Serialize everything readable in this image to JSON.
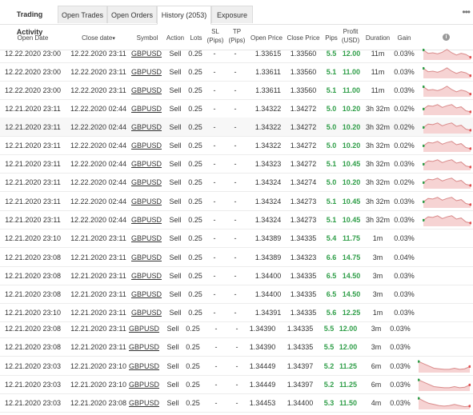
{
  "tabs": {
    "title": "Trading Activity",
    "open_trades": "Open Trades",
    "open_orders": "Open Orders",
    "history": "History (2053)",
    "exposure": "Exposure"
  },
  "headers": {
    "open_date": "Open Date",
    "close_date": "Close date",
    "sort_indicator": "▾",
    "symbol": "Symbol",
    "action": "Action",
    "lots": "Lots",
    "sl_1": "SL",
    "sl_2": "(Pips)",
    "tp_1": "TP",
    "tp_2": "(Pips)",
    "open_price": "Open Price",
    "close_price": "Close Price",
    "pips": "Pips",
    "profit_1": "Profit",
    "profit_2": "(USD)",
    "duration": "Duration",
    "gain": "Gain",
    "info": "i"
  },
  "colors": {
    "profit_green": "#2f9e48",
    "spark_fill": "#f6d3d3",
    "spark_line": "#d98a8a",
    "spark_start": "#2f9e48",
    "spark_end": "#e05050"
  },
  "rows": [
    {
      "open": "12.22.2020 23:00",
      "close": "12.22.2020 23:11",
      "symbol": "GBPUSD",
      "action": "Sell",
      "lots": "0.25",
      "sl": "-",
      "tp": "-",
      "open_price": "1.33615",
      "close_price": "1.33560",
      "pips": "5.5",
      "profit": "12.00",
      "duration": "11m",
      "gain": "0.03%",
      "spark": [
        0.25,
        0.55,
        0.5,
        0.6,
        0.45,
        0.2,
        0.5,
        0.7,
        0.55,
        0.65,
        0.9
      ]
    },
    {
      "open": "12.22.2020 23:00",
      "close": "12.22.2020 23:11",
      "symbol": "GBPUSD",
      "action": "Sell",
      "lots": "0.25",
      "sl": "-",
      "tp": "-",
      "open_price": "1.33611",
      "close_price": "1.33560",
      "pips": "5.1",
      "profit": "11.00",
      "duration": "11m",
      "gain": "0.03%",
      "spark": [
        0.25,
        0.55,
        0.5,
        0.6,
        0.45,
        0.2,
        0.5,
        0.7,
        0.55,
        0.65,
        0.9
      ]
    },
    {
      "open": "12.22.2020 23:00",
      "close": "12.22.2020 23:11",
      "symbol": "GBPUSD",
      "action": "Sell",
      "lots": "0.25",
      "sl": "-",
      "tp": "-",
      "open_price": "1.33611",
      "close_price": "1.33560",
      "pips": "5.1",
      "profit": "11.00",
      "duration": "11m",
      "gain": "0.03%",
      "spark": [
        0.25,
        0.55,
        0.5,
        0.6,
        0.45,
        0.2,
        0.5,
        0.7,
        0.55,
        0.65,
        0.9
      ]
    },
    {
      "open": "12.21.2020 23:11",
      "close": "12.22.2020 02:44",
      "symbol": "GBPUSD",
      "action": "Sell",
      "lots": "0.25",
      "sl": "-",
      "tp": "-",
      "open_price": "1.34322",
      "close_price": "1.34272",
      "pips": "5.0",
      "profit": "10.20",
      "duration": "3h 32m",
      "gain": "0.02%",
      "spark": [
        0.6,
        0.3,
        0.35,
        0.2,
        0.45,
        0.3,
        0.2,
        0.5,
        0.4,
        0.75,
        0.85
      ]
    },
    {
      "open": "12.21.2020 23:11",
      "close": "12.22.2020 02:44",
      "symbol": "GBPUSD",
      "action": "Sell",
      "lots": "0.25",
      "sl": "-",
      "tp": "-",
      "open_price": "1.34322",
      "close_price": "1.34272",
      "pips": "5.0",
      "profit": "10.20",
      "duration": "3h 32m",
      "gain": "0.02%",
      "spark": [
        0.6,
        0.3,
        0.35,
        0.2,
        0.45,
        0.3,
        0.2,
        0.5,
        0.4,
        0.75,
        0.85
      ]
    },
    {
      "open": "12.21.2020 23:11",
      "close": "12.22.2020 02:44",
      "symbol": "GBPUSD",
      "action": "Sell",
      "lots": "0.25",
      "sl": "-",
      "tp": "-",
      "open_price": "1.34322",
      "close_price": "1.34272",
      "pips": "5.0",
      "profit": "10.20",
      "duration": "3h 32m",
      "gain": "0.02%",
      "spark": [
        0.6,
        0.3,
        0.35,
        0.2,
        0.45,
        0.3,
        0.2,
        0.5,
        0.4,
        0.75,
        0.85
      ]
    },
    {
      "open": "12.21.2020 23:11",
      "close": "12.22.2020 02:44",
      "symbol": "GBPUSD",
      "action": "Sell",
      "lots": "0.25",
      "sl": "-",
      "tp": "-",
      "open_price": "1.34323",
      "close_price": "1.34272",
      "pips": "5.1",
      "profit": "10.45",
      "duration": "3h 32m",
      "gain": "0.03%",
      "spark": [
        0.6,
        0.3,
        0.35,
        0.2,
        0.45,
        0.3,
        0.2,
        0.5,
        0.4,
        0.75,
        0.85
      ]
    },
    {
      "open": "12.21.2020 23:11",
      "close": "12.22.2020 02:44",
      "symbol": "GBPUSD",
      "action": "Sell",
      "lots": "0.25",
      "sl": "-",
      "tp": "-",
      "open_price": "1.34324",
      "close_price": "1.34274",
      "pips": "5.0",
      "profit": "10.20",
      "duration": "3h 32m",
      "gain": "0.02%",
      "spark": [
        0.6,
        0.3,
        0.35,
        0.2,
        0.45,
        0.3,
        0.2,
        0.5,
        0.4,
        0.75,
        0.85
      ]
    },
    {
      "open": "12.21.2020 23:11",
      "close": "12.22.2020 02:44",
      "symbol": "GBPUSD",
      "action": "Sell",
      "lots": "0.25",
      "sl": "-",
      "tp": "-",
      "open_price": "1.34324",
      "close_price": "1.34273",
      "pips": "5.1",
      "profit": "10.45",
      "duration": "3h 32m",
      "gain": "0.03%",
      "spark": [
        0.6,
        0.3,
        0.35,
        0.2,
        0.45,
        0.3,
        0.2,
        0.5,
        0.4,
        0.75,
        0.85
      ]
    },
    {
      "open": "12.21.2020 23:11",
      "close": "12.22.2020 02:44",
      "symbol": "GBPUSD",
      "action": "Sell",
      "lots": "0.25",
      "sl": "-",
      "tp": "-",
      "open_price": "1.34324",
      "close_price": "1.34273",
      "pips": "5.1",
      "profit": "10.45",
      "duration": "3h 32m",
      "gain": "0.03%",
      "spark": [
        0.6,
        0.3,
        0.35,
        0.2,
        0.45,
        0.3,
        0.2,
        0.5,
        0.4,
        0.75,
        0.85
      ]
    },
    {
      "open": "12.21.2020 23:10",
      "close": "12.21.2020 23:11",
      "symbol": "GBPUSD",
      "action": "Sell",
      "lots": "0.25",
      "sl": "-",
      "tp": "-",
      "open_price": "1.34389",
      "close_price": "1.34335",
      "pips": "5.4",
      "profit": "11.75",
      "duration": "1m",
      "gain": "0.03%",
      "spark": null
    },
    {
      "open": "12.21.2020 23:08",
      "close": "12.21.2020 23:11",
      "symbol": "GBPUSD",
      "action": "Sell",
      "lots": "0.25",
      "sl": "-",
      "tp": "-",
      "open_price": "1.34389",
      "close_price": "1.34323",
      "pips": "6.6",
      "profit": "14.75",
      "duration": "3m",
      "gain": "0.04%",
      "spark": null
    },
    {
      "open": "12.21.2020 23:08",
      "close": "12.21.2020 23:11",
      "symbol": "GBPUSD",
      "action": "Sell",
      "lots": "0.25",
      "sl": "-",
      "tp": "-",
      "open_price": "1.34400",
      "close_price": "1.34335",
      "pips": "6.5",
      "profit": "14.50",
      "duration": "3m",
      "gain": "0.03%",
      "spark": null
    },
    {
      "open": "12.21.2020 23:08",
      "close": "12.21.2020 23:11",
      "symbol": "GBPUSD",
      "action": "Sell",
      "lots": "0.25",
      "sl": "-",
      "tp": "-",
      "open_price": "1.34400",
      "close_price": "1.34335",
      "pips": "6.5",
      "profit": "14.50",
      "duration": "3m",
      "gain": "0.03%",
      "spark": null
    },
    {
      "open": "12.21.2020 23:10",
      "close": "12.21.2020 23:11",
      "symbol": "GBPUSD",
      "action": "Sell",
      "lots": "0.25",
      "sl": "-",
      "tp": "-",
      "open_price": "1.34391",
      "close_price": "1.34335",
      "pips": "5.6",
      "profit": "12.25",
      "duration": "1m",
      "gain": "0.03%",
      "spark": null
    },
    {
      "open": "12.21.2020 23:08",
      "close": "12.21.2020 23:11",
      "symbol": "GBPUSD",
      "action": "Sell",
      "lots": "0.25",
      "sl": "-",
      "tp": "-",
      "open_price": "1.34390",
      "close_price": "1.34335",
      "pips": "5.5",
      "profit": "12.00",
      "duration": "3m",
      "gain": "0.03%",
      "spark": null
    },
    {
      "open": "12.21.2020 23:08",
      "close": "12.21.2020 23:11",
      "symbol": "GBPUSD",
      "action": "Sell",
      "lots": "0.25",
      "sl": "-",
      "tp": "-",
      "open_price": "1.34390",
      "close_price": "1.34335",
      "pips": "5.5",
      "profit": "12.00",
      "duration": "3m",
      "gain": "0.03%",
      "spark": null
    },
    {
      "open": "12.21.2020 23:03",
      "close": "12.21.2020 23:10",
      "symbol": "GBPUSD",
      "action": "Sell",
      "lots": "0.25",
      "sl": "-",
      "tp": "-",
      "open_price": "1.34449",
      "close_price": "1.34397",
      "pips": "5.2",
      "profit": "11.25",
      "duration": "6m",
      "gain": "0.03%",
      "spark": [
        0.15,
        0.35,
        0.55,
        0.75,
        0.8,
        0.85,
        0.85,
        0.75,
        0.85,
        0.8,
        0.6
      ]
    },
    {
      "open": "12.21.2020 23:03",
      "close": "12.21.2020 23:10",
      "symbol": "GBPUSD",
      "action": "Sell",
      "lots": "0.25",
      "sl": "-",
      "tp": "-",
      "open_price": "1.34449",
      "close_price": "1.34397",
      "pips": "5.2",
      "profit": "11.25",
      "duration": "6m",
      "gain": "0.03%",
      "spark": [
        0.15,
        0.35,
        0.55,
        0.75,
        0.8,
        0.85,
        0.85,
        0.75,
        0.85,
        0.8,
        0.6
      ]
    },
    {
      "open": "12.21.2020 23:03",
      "close": "12.21.2020 23:08",
      "symbol": "GBPUSD",
      "action": "Sell",
      "lots": "0.25",
      "sl": "-",
      "tp": "-",
      "open_price": "1.34453",
      "close_price": "1.34400",
      "pips": "5.3",
      "profit": "11.50",
      "duration": "4m",
      "gain": "0.03%",
      "spark": [
        0.15,
        0.4,
        0.6,
        0.7,
        0.8,
        0.85,
        0.8,
        0.7,
        0.8,
        0.9,
        0.85
      ]
    }
  ]
}
